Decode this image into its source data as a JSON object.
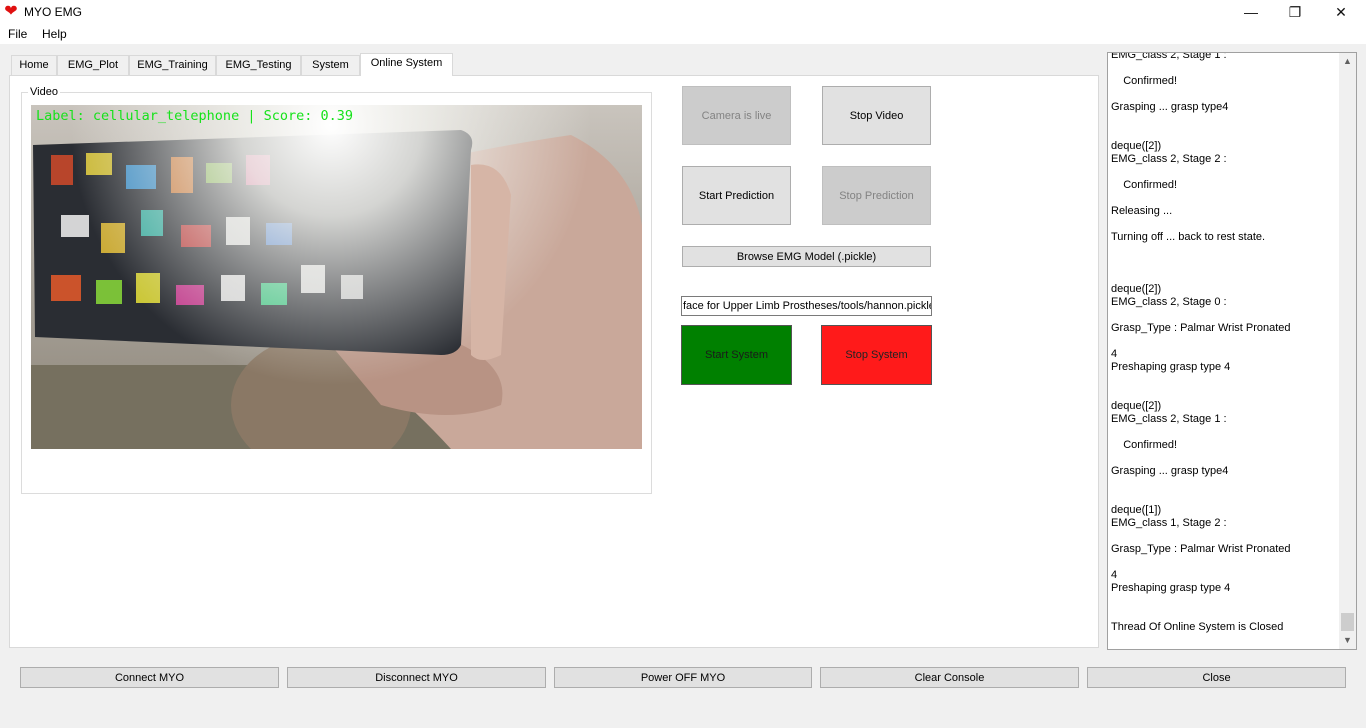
{
  "window": {
    "title": "MYO EMG",
    "app_icon": "heart-icon",
    "controls": {
      "minimize": "—",
      "restore": "❐",
      "close": "✕"
    }
  },
  "menu": {
    "items": [
      "File",
      "Help"
    ]
  },
  "tabs": {
    "items": [
      "Home",
      "EMG_Plot",
      "EMG_Training",
      "EMG_Testing",
      "System",
      "Online System"
    ],
    "active": "Online System"
  },
  "video": {
    "group_label": "Video",
    "overlay": "Label: cellular_telephone | Score: 0.39"
  },
  "controls": {
    "camera_live": "Camera is live",
    "stop_video": "Stop Video",
    "start_prediction": "Start Prediction",
    "stop_prediction": "Stop Prediction",
    "browse_model": "Browse EMG Model (.pickle)",
    "model_path": "face for Upper Limb Prostheses/tools/hannon.pickle",
    "start_system": "Start System",
    "stop_system": "Stop System"
  },
  "console": {
    "lines": [
      "EMG_class 2, Stage 1 :",
      "",
      "    Confirmed!",
      "",
      "Grasping ... grasp type4",
      "",
      "",
      "deque([2])",
      "EMG_class 2, Stage 2 :",
      "",
      "    Confirmed!",
      "",
      "Releasing ...",
      "",
      "Turning off ... back to rest state.",
      "",
      "",
      "",
      "deque([2])",
      "EMG_class 2, Stage 0 :",
      "",
      "Grasp_Type : Palmar Wrist Pronated",
      "",
      "4",
      "Preshaping grasp type 4",
      "",
      "",
      "deque([2])",
      "EMG_class 2, Stage 1 :",
      "",
      "    Confirmed!",
      "",
      "Grasping ... grasp type4",
      "",
      "",
      "deque([1])",
      "EMG_class 1, Stage 2 :",
      "",
      "Grasp_Type : Palmar Wrist Pronated",
      "",
      "4",
      "Preshaping grasp type 4",
      "",
      "",
      "Thread Of Online System is Closed"
    ]
  },
  "bottom_bar": {
    "connect": "Connect MYO",
    "disconnect": "Disconnect MYO",
    "power_off": "Power OFF MYO",
    "clear_console": "Clear Console",
    "close": "Close"
  },
  "colors": {
    "start_system": "#008000",
    "stop_system": "#ff1a1a",
    "overlay_text": "#16e21a"
  }
}
